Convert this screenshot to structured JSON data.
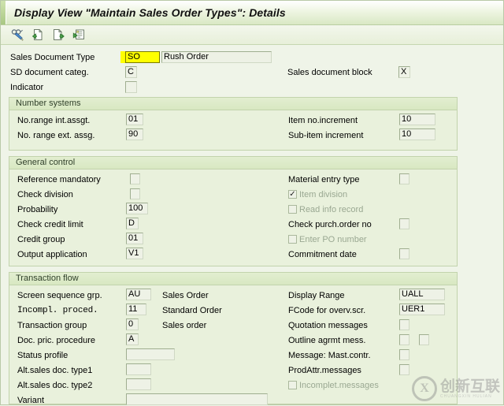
{
  "window": {
    "title": "Display View \"Maintain Sales Order Types\": Details"
  },
  "toolbar": {
    "buttons": [
      {
        "name": "display-change-icon",
        "glyph": "✎",
        "tooltip": "Display <-> Change"
      },
      {
        "name": "new-entries-icon",
        "glyph": "⎘",
        "tooltip": "New Entries"
      },
      {
        "name": "copy-as-icon",
        "glyph": "❐",
        "tooltip": "Copy As"
      },
      {
        "name": "details-icon",
        "glyph": "≣",
        "tooltip": "Details"
      }
    ]
  },
  "header_fields": {
    "sales_document_type": {
      "label": "Sales Document Type",
      "value": "SO",
      "description": "Rush Order",
      "highlighted": true
    },
    "sd_document_categ": {
      "label": "SD document categ.",
      "value": "C"
    },
    "indicator": {
      "label": "Indicator",
      "value": ""
    },
    "sales_document_block": {
      "label": "Sales document block",
      "value": "X"
    }
  },
  "number_systems": {
    "title": "Number systems",
    "left": [
      {
        "label": "No.range int.assgt.",
        "value": "01"
      },
      {
        "label": "No. range ext. assg.",
        "value": "90"
      }
    ],
    "right": [
      {
        "label": "Item no.increment",
        "value": "10"
      },
      {
        "label": "Sub-item increment",
        "value": "10"
      }
    ]
  },
  "general_control": {
    "title": "General control",
    "left": [
      {
        "label": "Reference mandatory",
        "type": "checkbox",
        "checked": false
      },
      {
        "label": "Check division",
        "type": "checkbox",
        "checked": false
      },
      {
        "label": "Probability",
        "type": "input",
        "value": "100"
      },
      {
        "label": "Check credit limit",
        "type": "input",
        "value": "D"
      },
      {
        "label": "Credit group",
        "type": "input",
        "value": "01"
      },
      {
        "label": "Output application",
        "type": "input",
        "value": "V1"
      }
    ],
    "right": [
      {
        "label": "Material entry type",
        "type": "checkbox",
        "checked": false,
        "disabled": false
      },
      {
        "label": "Item division",
        "type": "inline-checkbox",
        "checked": true,
        "disabled": true
      },
      {
        "label": "Read info record",
        "type": "inline-checkbox",
        "checked": false,
        "disabled": true
      },
      {
        "label": "Check purch.order no",
        "type": "checkbox",
        "checked": false,
        "disabled": false
      },
      {
        "label": "Enter PO number",
        "type": "inline-checkbox",
        "checked": false,
        "disabled": true
      },
      {
        "label": "Commitment  date",
        "type": "checkbox",
        "checked": false,
        "disabled": false
      }
    ]
  },
  "transaction_flow": {
    "title": "Transaction flow",
    "left": [
      {
        "label": "Screen sequence grp.",
        "value": "AU",
        "description": "Sales Order",
        "mono": false
      },
      {
        "label": "Incompl. proced.",
        "value": "11",
        "description": "Standard Order",
        "mono": true
      },
      {
        "label": "Transaction group",
        "value": "0",
        "description": "Sales order",
        "mono": false
      },
      {
        "label": "Doc. pric. procedure",
        "value": "A",
        "description": "",
        "mono": false
      },
      {
        "label": "Status profile",
        "value": "",
        "description": "",
        "mono": false,
        "wide": true
      },
      {
        "label": "Alt.sales doc. type1",
        "value": "",
        "description": "",
        "mono": false
      },
      {
        "label": "Alt.sales doc. type2",
        "value": "",
        "description": "",
        "mono": false
      },
      {
        "label": "Variant",
        "value": "",
        "description": "",
        "mono": false,
        "xwide": true
      }
    ],
    "right": [
      {
        "label": "Display Range",
        "type": "input",
        "value": "UALL"
      },
      {
        "label": "FCode for overv.scr.",
        "type": "input",
        "value": "UER1"
      },
      {
        "label": "Quotation messages",
        "type": "checkbox",
        "checked": false
      },
      {
        "label": "Outline agrmt mess.",
        "type": "checkbox2",
        "checked": false
      },
      {
        "label": "Message: Mast.contr.",
        "type": "checkbox",
        "checked": false
      },
      {
        "label": "ProdAttr.messages",
        "type": "checkbox",
        "checked": false
      },
      {
        "label": "Incomplet.messages",
        "type": "inline-checkbox",
        "checked": false,
        "disabled": true
      }
    ]
  },
  "watermark": {
    "mark": "X",
    "text": "创新互联",
    "sub": "CHUANGXIN HULIAN"
  },
  "colors": {
    "panel_bg": "#e9f1dc",
    "window_bg": "#eff4e8",
    "header_grad_top": "#e2eed0",
    "field_border": "#9fae90",
    "highlight": "#ffff00"
  }
}
